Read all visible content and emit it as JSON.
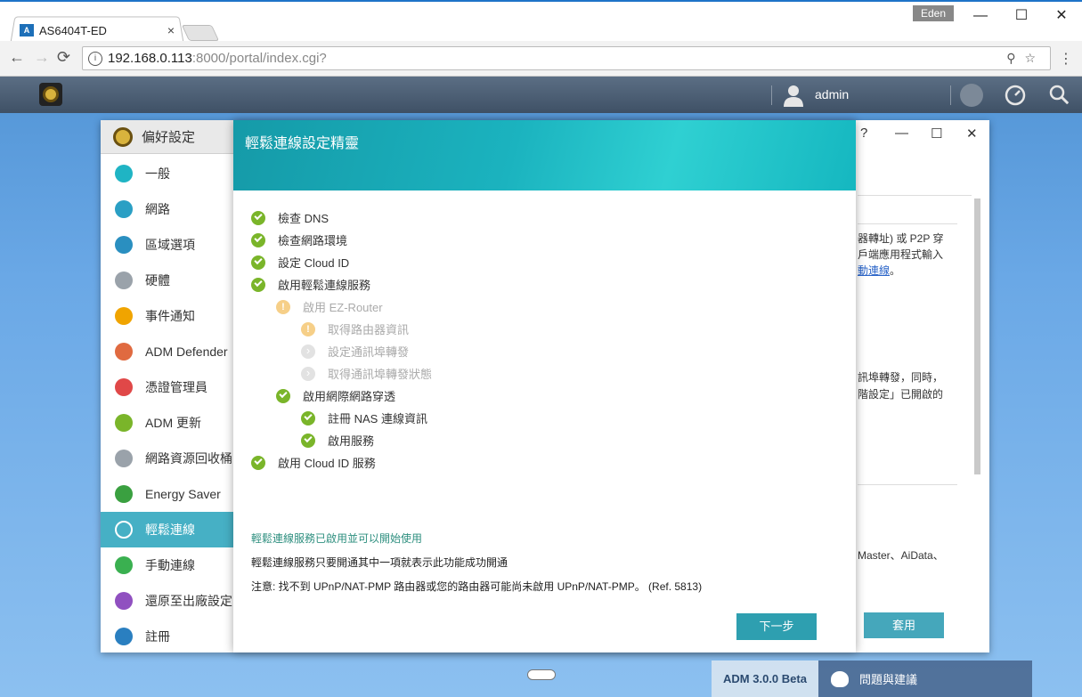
{
  "browser": {
    "tab_title": "AS6404T-ED",
    "tab_favicon": "A",
    "tab_close": "×",
    "profile": "Eden",
    "url_host": "192.168.0.113",
    "url_path": ":8000/portal/index.cgi?",
    "url_info": "i",
    "back": "←",
    "forward": "→",
    "reload": "⟳",
    "minimize": "—",
    "maximize": "☐",
    "close": "✕",
    "url_right_icons": "⚲☆",
    "menu": "⋮"
  },
  "adm_bar": {
    "username": "admin"
  },
  "pref_window": {
    "title": "偏好設定",
    "controls": {
      "help": "?",
      "minimize": "—",
      "maximize": "☐",
      "close": "✕"
    },
    "sidebar": [
      {
        "label": "一般",
        "icon": "general-icon",
        "color": "#1fb4c4"
      },
      {
        "label": "網路",
        "icon": "globe-icon",
        "color": "#2a9fc4"
      },
      {
        "label": "區域選項",
        "icon": "region-icon",
        "color": "#2a8fc0"
      },
      {
        "label": "硬體",
        "icon": "hardware-icon",
        "color": "#9aa2aa"
      },
      {
        "label": "事件通知",
        "icon": "notification-icon",
        "color": "#f0a400"
      },
      {
        "label": "ADM Defender",
        "icon": "firewall-icon",
        "color": "#e06a40"
      },
      {
        "label": "憑證管理員",
        "icon": "certificate-icon",
        "color": "#e04848"
      },
      {
        "label": "ADM 更新",
        "icon": "update-icon",
        "color": "#7ab52a"
      },
      {
        "label": "網路資源回收桶",
        "icon": "recycle-bin-icon",
        "color": "#9aa2aa"
      },
      {
        "label": "Energy Saver",
        "icon": "energy-icon",
        "color": "#3aa040"
      },
      {
        "label": "輕鬆連線",
        "icon": "cloud-icon",
        "color": "#ffffff",
        "active": true
      },
      {
        "label": "手動連線",
        "icon": "manual-connect-icon",
        "color": "#3ab050"
      },
      {
        "label": "還原至出廠設定",
        "icon": "restore-icon",
        "color": "#9050c0"
      },
      {
        "label": "註冊",
        "icon": "register-icon",
        "color": "#2a7fc0"
      }
    ],
    "right_text": {
      "line1": "器轉址) 或 P2P 穿",
      "line2": "戶端應用程式輸入",
      "line3_link": "動連線",
      "line3_tail": "。",
      "line4": "訊埠轉發，同時，",
      "line5": "階設定」已開啟的",
      "line6": "Master、AiData、"
    },
    "apply_label": "套用"
  },
  "wizard": {
    "title": "輕鬆連線設定精靈",
    "steps": [
      {
        "label": "檢查 DNS",
        "status": "ok"
      },
      {
        "label": "檢查網路環境",
        "status": "ok"
      },
      {
        "label": "設定 Cloud ID",
        "status": "ok"
      },
      {
        "label": "啟用輕鬆連線服務",
        "status": "ok"
      },
      {
        "label": "啟用 EZ-Router",
        "status": "warn"
      },
      {
        "label": "取得路由器資訊",
        "status": "warn"
      },
      {
        "label": "設定通訊埠轉發",
        "status": "pending"
      },
      {
        "label": "取得通訊埠轉發狀態",
        "status": "pending"
      },
      {
        "label": "啟用網際網路穿透",
        "status": "ok"
      },
      {
        "label": "註冊 NAS 連線資訊",
        "status": "ok"
      },
      {
        "label": "啟用服務",
        "status": "ok"
      },
      {
        "label": "啟用 Cloud ID 服務",
        "status": "ok"
      }
    ],
    "success_message": "輕鬆連線服務已啟用並可以開始使用",
    "info_message": "輕鬆連線服務只要開通其中一項就表示此功能成功開通",
    "note_message": "注意: 找不到 UPnP/NAT-PMP 路由器或您的路由器可能尚未啟用 UPnP/NAT-PMP。 (Ref. 5813)",
    "next_label": "下一步"
  },
  "footer": {
    "version": "ADM 3.0.0 Beta",
    "feedback": "問題與建議"
  }
}
